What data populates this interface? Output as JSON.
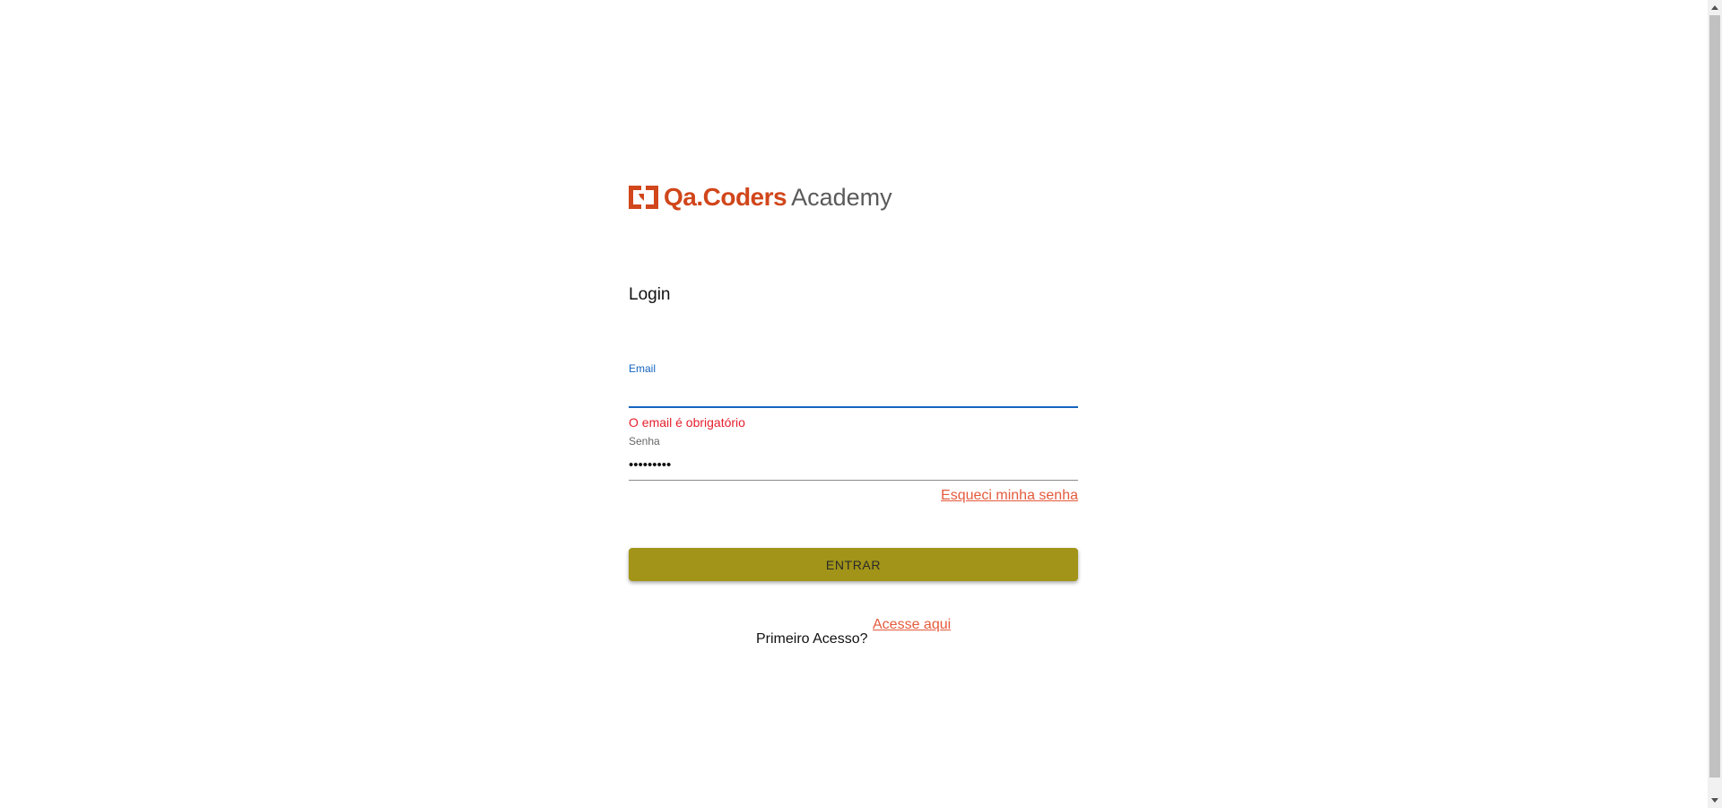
{
  "brand": {
    "name": "Qa.Coders",
    "suffix": "Academy",
    "logo_icon": "qa-coders-logo-icon",
    "accent_color": "#d1461b"
  },
  "login": {
    "title": "Login"
  },
  "form": {
    "email": {
      "label": "Email",
      "value": "",
      "error": "O email é obrigatório"
    },
    "senha": {
      "label": "Senha",
      "value": "•••••••••"
    },
    "forgot_password": "Esqueci minha senha",
    "submit_label": "ENTRAR",
    "submit_color": "#a19418"
  },
  "first_access": {
    "prompt": "Primeiro Acesso?",
    "link": "Acesse aqui"
  }
}
